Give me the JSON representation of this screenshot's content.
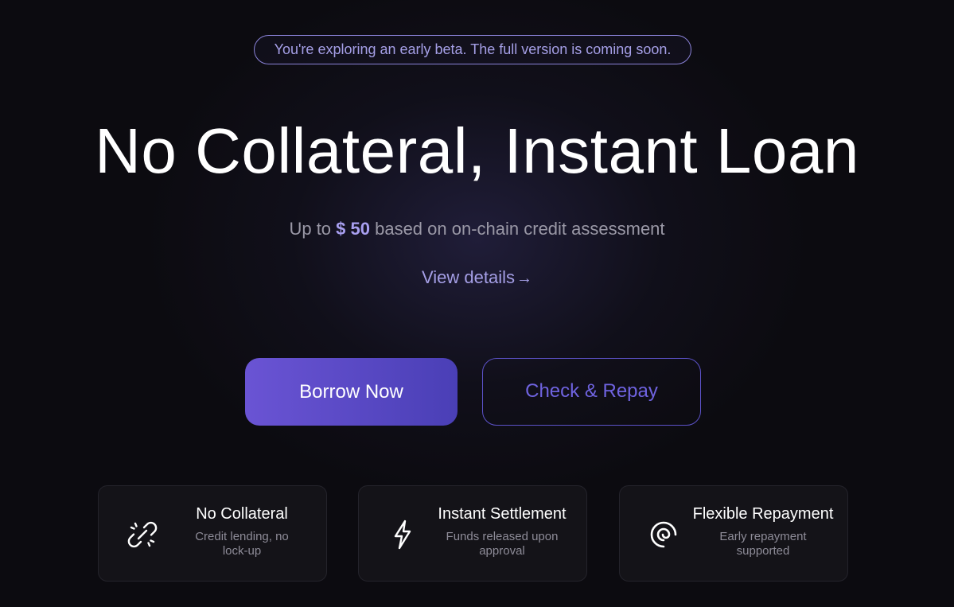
{
  "banner": {
    "text": "You're exploring an early beta. The full version is coming soon."
  },
  "hero": {
    "title": "No Collateral, Instant Loan",
    "subtitle_prefix": "Up to ",
    "subtitle_amount": "$ 50",
    "subtitle_suffix": " based on on-chain credit assessment",
    "view_details_label": "View details",
    "view_details_icon": "arrow-right-icon"
  },
  "actions": {
    "borrow_label": "Borrow Now",
    "check_repay_label": "Check & Repay"
  },
  "features": [
    {
      "icon": "broken-link-icon",
      "title": "No Collateral",
      "description": "Credit lending, no lock-up"
    },
    {
      "icon": "lightning-bolt-icon",
      "title": "Instant Settlement",
      "description": "Funds released upon approval"
    },
    {
      "icon": "spiral-icon",
      "title": "Flexible Repayment",
      "description": "Early repayment supported"
    }
  ],
  "colors": {
    "background": "#0c0b10",
    "accent": "#a59fe6",
    "primary_button": "#5b4ac8",
    "secondary_button_text": "#6f63e0"
  }
}
